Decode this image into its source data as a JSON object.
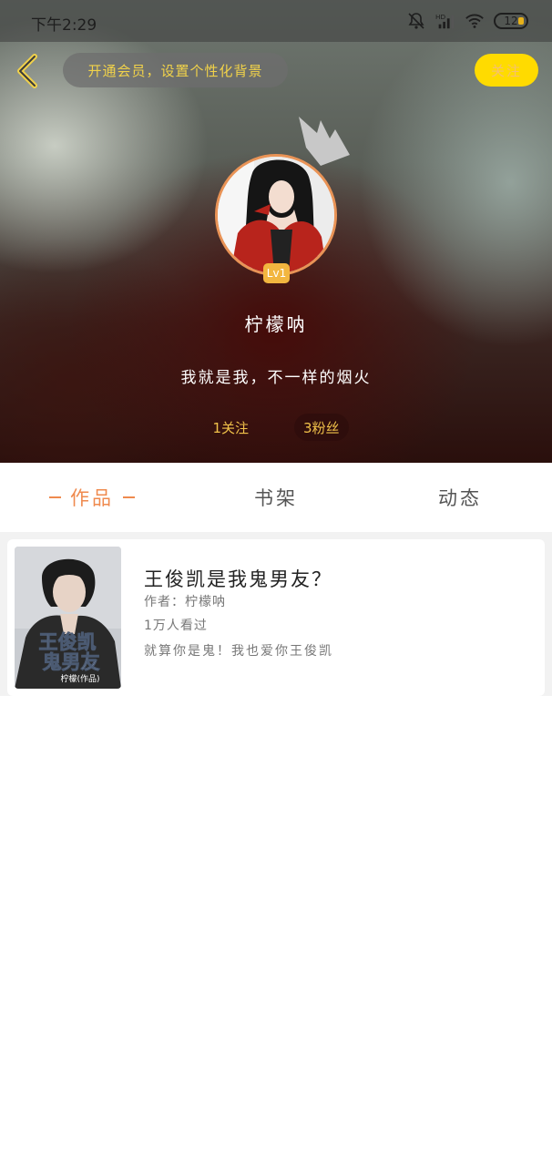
{
  "status_bar": {
    "time": "下午2:29",
    "battery_level": "12"
  },
  "header": {
    "background_hint": "开通会员，设置个性化背景",
    "follow_button": "关注",
    "avatar_level": "Lv1",
    "username": "柠檬呐",
    "bio": "我就是我，不一样的烟火",
    "following": "1关注",
    "fans": "3粉丝"
  },
  "tabs": [
    {
      "label": "作品",
      "active": true
    },
    {
      "label": "书架",
      "active": false
    },
    {
      "label": "动态",
      "active": false
    }
  ],
  "works": [
    {
      "title": "王俊凯是我鬼男友？",
      "author": "作者：柠檬呐",
      "views": "1万人看过",
      "description": "就算你是鬼！我也爱你王俊凯",
      "cover_title_line1": "王俊凯",
      "cover_title_line2": "鬼男友",
      "cover_caption": "柠檬(作品)"
    }
  ],
  "colors": {
    "accent": "#ef8a4e",
    "follow_bg": "#ffdb00",
    "badge": "#f2b63f",
    "hint_text": "#f1d24a"
  }
}
